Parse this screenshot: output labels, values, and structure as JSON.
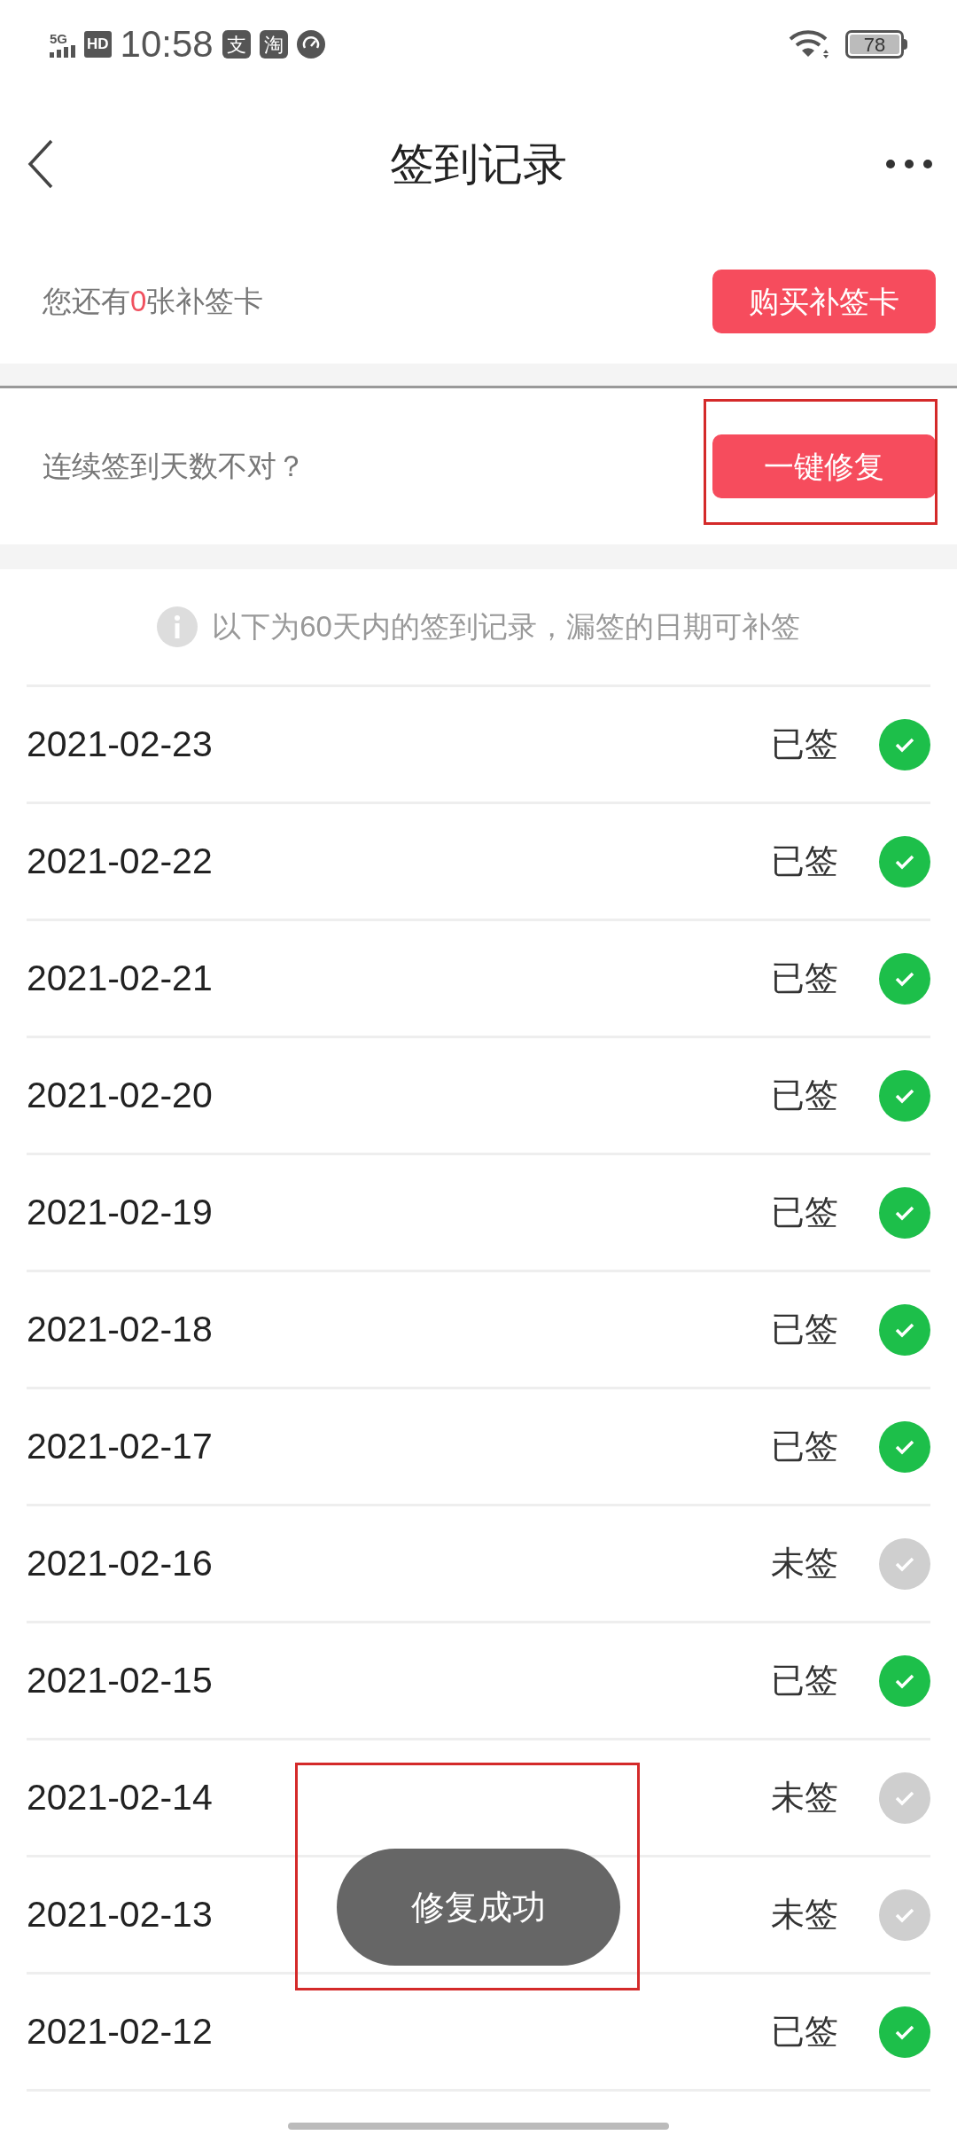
{
  "status_bar": {
    "network": "5G",
    "hd": "HD",
    "time": "10:58",
    "app_badges": [
      "支",
      "淘"
    ],
    "battery": "78"
  },
  "header": {
    "title": "签到记录"
  },
  "card_info": {
    "text": "您还有**0**张补签卡",
    "button": "购买补签卡"
  },
  "repair": {
    "text": "连续签到天数不对？",
    "button": "一键修复",
    "highlighted": true
  },
  "notice": "以下为60天内的签到记录，漏签的日期可补签",
  "records": [
    {
      "date": "2021-02-23",
      "status": "已签",
      "signed": true
    },
    {
      "date": "2021-02-22",
      "status": "已签",
      "signed": true
    },
    {
      "date": "2021-02-21",
      "status": "已签",
      "signed": true
    },
    {
      "date": "2021-02-20",
      "status": "已签",
      "signed": true
    },
    {
      "date": "2021-02-19",
      "status": "已签",
      "signed": true
    },
    {
      "date": "2021-02-18",
      "status": "已签",
      "signed": true
    },
    {
      "date": "2021-02-17",
      "status": "已签",
      "signed": true
    },
    {
      "date": "2021-02-16",
      "status": "未签",
      "signed": false
    },
    {
      "date": "2021-02-15",
      "status": "已签",
      "signed": true
    },
    {
      "date": "2021-02-14",
      "status": "未签",
      "signed": false
    },
    {
      "date": "2021-02-13",
      "status": "未签",
      "signed": false
    },
    {
      "date": "2021-02-12",
      "status": "已签",
      "signed": true
    }
  ],
  "toast": {
    "text": "修复成功",
    "highlighted": true
  }
}
